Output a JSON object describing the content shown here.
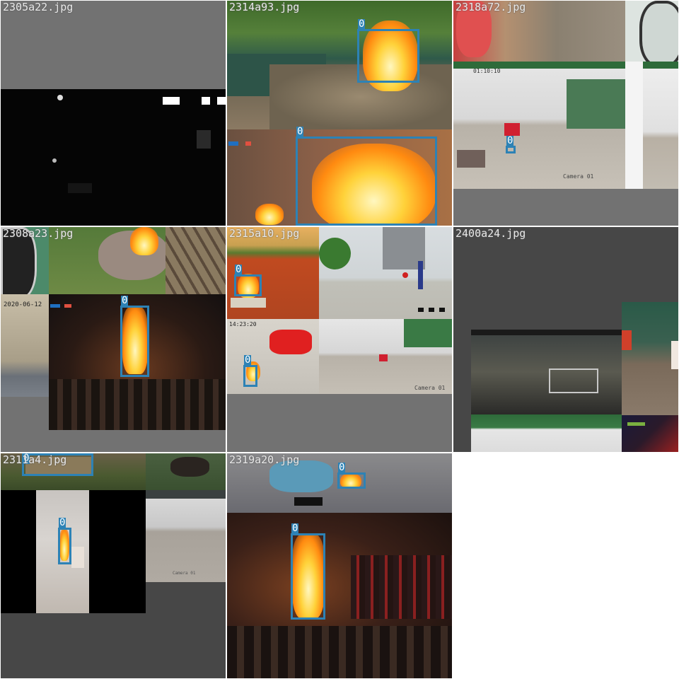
{
  "colors": {
    "accent_box": "#2d82b5",
    "tile_bg": "#727272",
    "tile_bg_dark": "#474747",
    "label_text": "#e8e8e8"
  },
  "tiles": [
    {
      "filename": "2305a22.jpg",
      "labels": []
    },
    {
      "filename": "2314a93.jpg",
      "labels": [
        "0",
        "0"
      ]
    },
    {
      "filename": "2318a72.jpg",
      "labels": [
        "0"
      ],
      "overlays": {
        "timestamp": "01:10:10",
        "camera": "Camera 01"
      }
    },
    {
      "filename": "2308a23.jpg",
      "labels": [
        "0"
      ],
      "overlays": {
        "date": "2020-06-12"
      }
    },
    {
      "filename": "2315a10.jpg",
      "labels": [
        "0",
        "0"
      ],
      "overlays": {
        "time": "14:23:20",
        "camera": "Camera 01"
      }
    },
    {
      "filename": "2400a24.jpg",
      "labels": []
    },
    {
      "filename": "2311a4.jpg",
      "labels": [
        "0",
        "0"
      ],
      "overlays": {
        "camera": "Camera 01"
      }
    },
    {
      "filename": "2319a20.jpg",
      "labels": [
        "0",
        "0"
      ]
    }
  ]
}
